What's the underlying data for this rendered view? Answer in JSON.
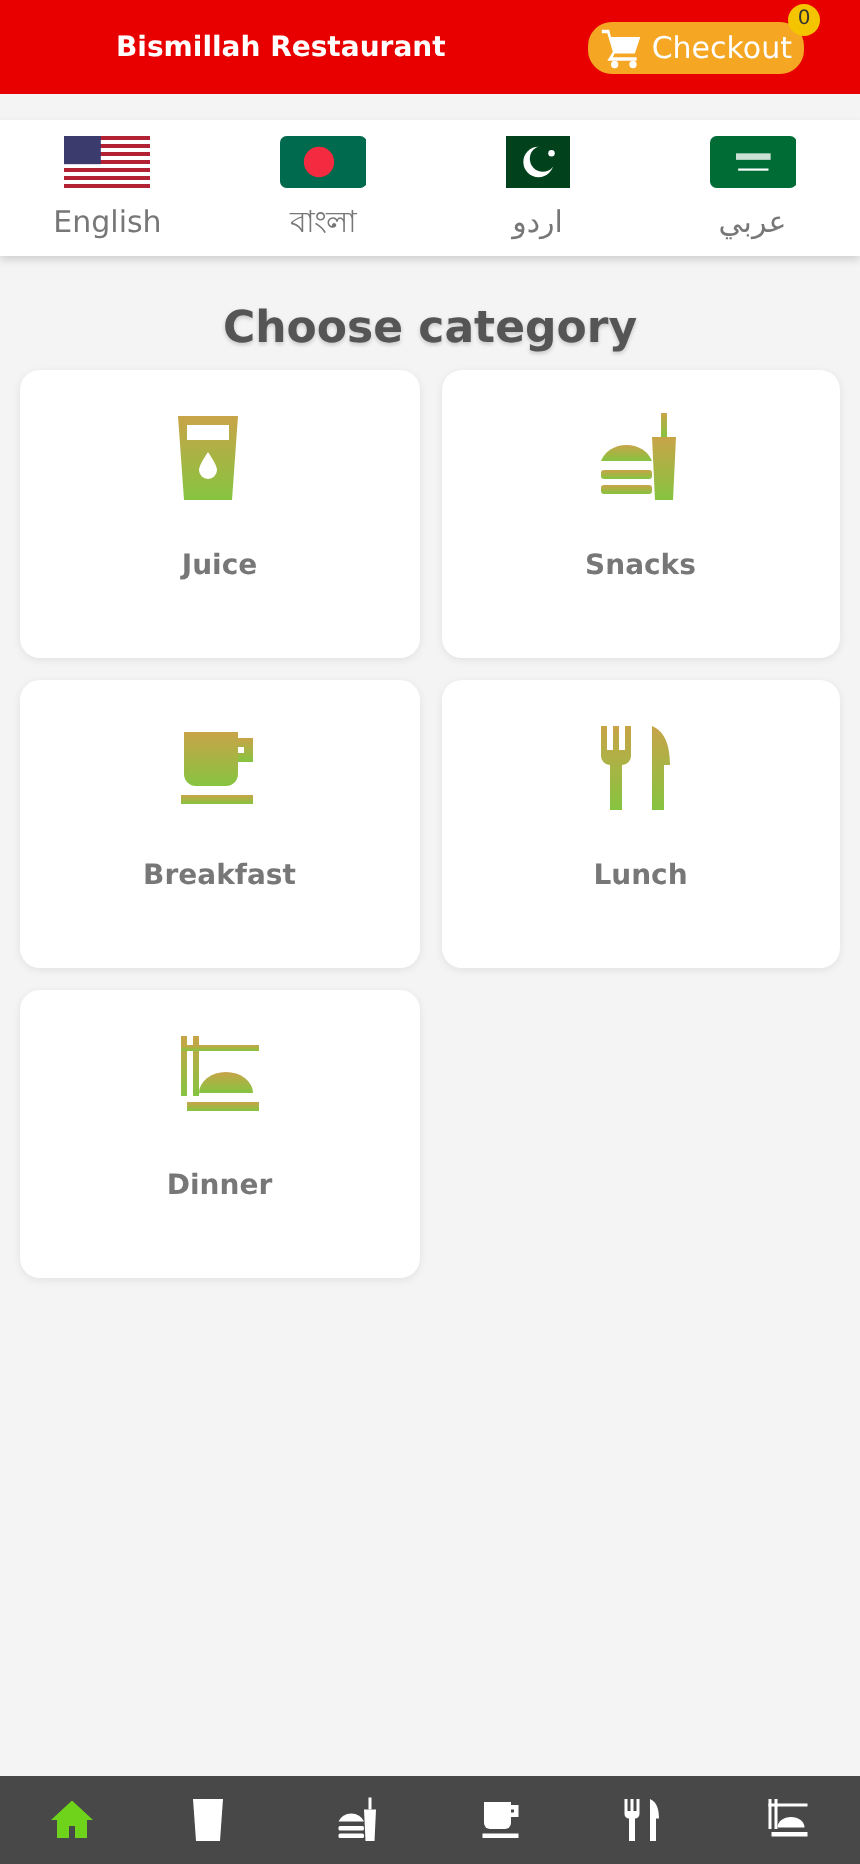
{
  "header": {
    "title": "Bismillah Restaurant",
    "checkout": {
      "label": "Checkout",
      "count": "0"
    }
  },
  "languages": [
    {
      "label": "English",
      "kind": "us"
    },
    {
      "label": "বাংলা",
      "kind": "bd"
    },
    {
      "label": "اردو",
      "kind": "pk"
    },
    {
      "label": "عربي",
      "kind": "sa"
    }
  ],
  "heading": "Choose category",
  "categories": [
    {
      "label": "Juice",
      "kind": "juice"
    },
    {
      "label": "Snacks",
      "kind": "snacks"
    },
    {
      "label": "Breakfast",
      "kind": "breakfast"
    },
    {
      "label": "Lunch",
      "kind": "lunch"
    },
    {
      "label": "Dinner",
      "kind": "dinner"
    }
  ],
  "bottom_nav": [
    {
      "kind": "home",
      "selected": true
    },
    {
      "kind": "juice",
      "selected": false
    },
    {
      "kind": "snacks",
      "selected": false
    },
    {
      "kind": "breakfast",
      "selected": false
    },
    {
      "kind": "lunch",
      "selected": false
    },
    {
      "kind": "dinner",
      "selected": false
    }
  ]
}
